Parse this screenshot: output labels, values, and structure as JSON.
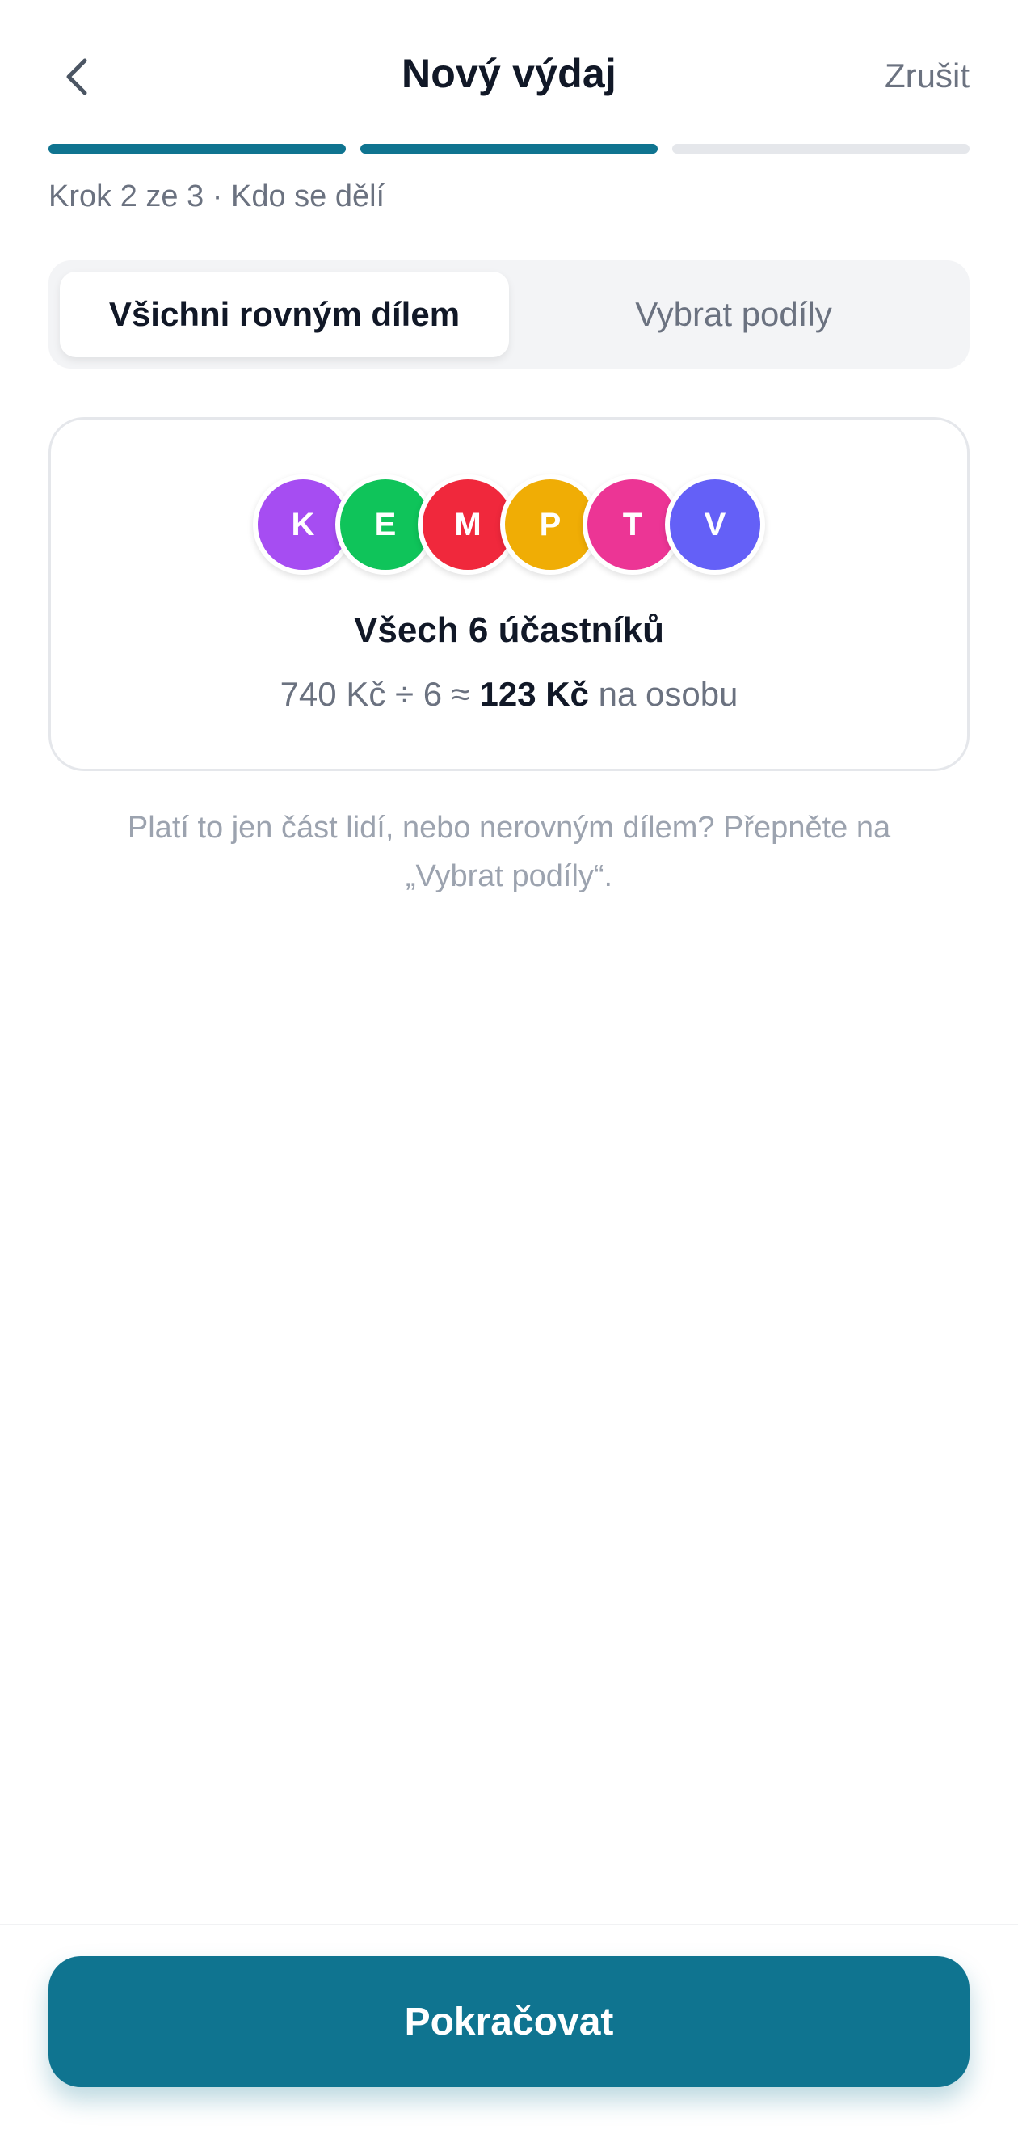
{
  "header": {
    "title": "Nový výdaj",
    "cancel_label": "Zrušit",
    "back_icon": "chevron-left-icon"
  },
  "progress": {
    "current_step": 2,
    "total_steps": 3,
    "label": "Krok 2 ze 3 · Kdo se dělí"
  },
  "split_mode": {
    "options": [
      {
        "label": "Všichni rovným dílem",
        "active": true
      },
      {
        "label": "Vybrat podíly",
        "active": false
      }
    ]
  },
  "participants": {
    "avatars": [
      {
        "initial": "K",
        "color": "#a64df2"
      },
      {
        "initial": "E",
        "color": "#0fc45a"
      },
      {
        "initial": "M",
        "color": "#f0283c"
      },
      {
        "initial": "P",
        "color": "#f0ad05"
      },
      {
        "initial": "T",
        "color": "#ec3595"
      },
      {
        "initial": "V",
        "color": "#6460f7"
      }
    ],
    "title": "Všech 6 účastníků",
    "calc_prefix": "740 Kč ÷ 6 ≈",
    "per_person": "123 Kč",
    "calc_suffix": "na osobu"
  },
  "hint": "Platí to jen část lidí, nebo nerovným dílem? Přepněte na „Vybrat podíly“.",
  "footer": {
    "continue_label": "Pokračovat"
  },
  "colors": {
    "primary": "#0f7490",
    "muted_text": "#6b7280",
    "hint_text": "#9ca3af"
  }
}
